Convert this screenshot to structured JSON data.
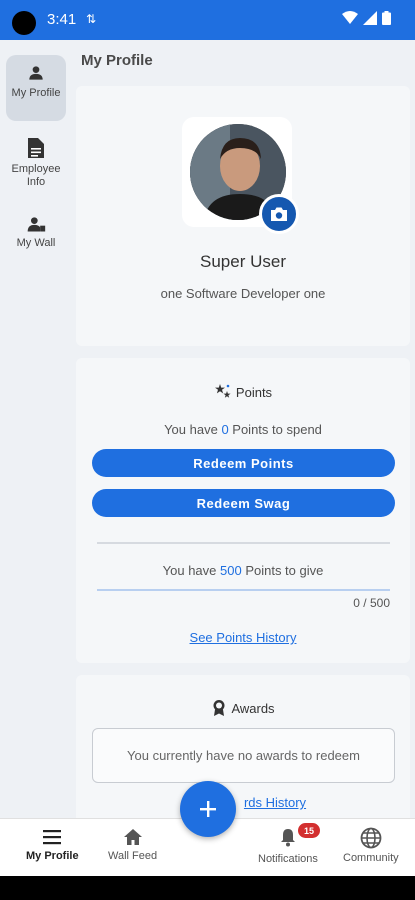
{
  "status_bar": {
    "time": "3:41",
    "data_indicator": "⇅"
  },
  "rail": {
    "items": [
      {
        "label": "My Profile",
        "icon": "person-icon"
      },
      {
        "label": "Employee Info",
        "icon": "document-icon"
      },
      {
        "label": "My Wall",
        "icon": "person-group-icon"
      }
    ]
  },
  "page": {
    "title": "My Profile"
  },
  "profile": {
    "name": "Super User",
    "role": "one Software Developer one"
  },
  "points": {
    "heading": "Points",
    "spend_prefix": "You have ",
    "spend_value": "0",
    "spend_suffix": " Points to spend",
    "redeem_points_label": "Redeem Points",
    "redeem_swag_label": "Redeem Swag",
    "give_prefix": "You have ",
    "give_value": "500",
    "give_suffix": " Points to give",
    "give_progress_label": "0 / 500",
    "give_progress_fraction": 0,
    "history_link": "See Points History"
  },
  "awards": {
    "heading": "Awards",
    "empty_text": "You currently have no awards to redeem",
    "history_link": "rds History"
  },
  "bottom_nav": {
    "items": [
      {
        "label": "My Profile",
        "icon": "menu-icon"
      },
      {
        "label": "Wall Feed",
        "icon": "home-icon"
      },
      {
        "label": "Notifications",
        "icon": "bell-icon",
        "badge": "15"
      },
      {
        "label": "Community",
        "icon": "globe-icon"
      }
    ]
  },
  "colors": {
    "primary": "#1f6fe0",
    "badge": "#d32f2f"
  }
}
